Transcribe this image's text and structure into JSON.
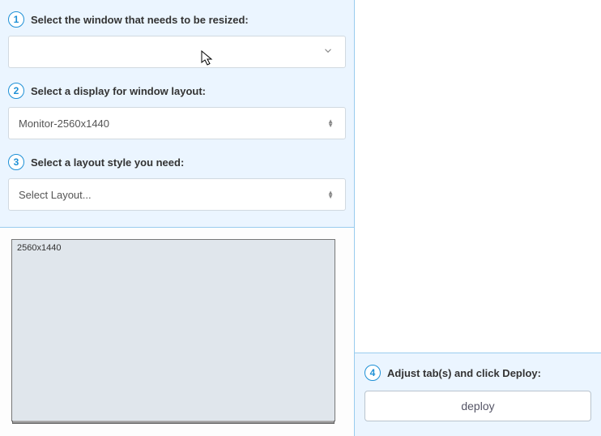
{
  "steps": {
    "s1": {
      "num": "1",
      "label": "Select the window that needs to be resized:"
    },
    "s2": {
      "num": "2",
      "label": "Select a display for window layout:"
    },
    "s3": {
      "num": "3",
      "label": "Select a layout style you need:"
    },
    "s4": {
      "num": "4",
      "label": "Adjust tab(s) and click Deploy:"
    }
  },
  "selects": {
    "window": {
      "value": ""
    },
    "display": {
      "value": "Monitor-2560x1440"
    },
    "layout": {
      "value": "Select Layout..."
    }
  },
  "preview": {
    "resolution_label": "2560x1440"
  },
  "buttons": {
    "deploy": "deploy"
  }
}
